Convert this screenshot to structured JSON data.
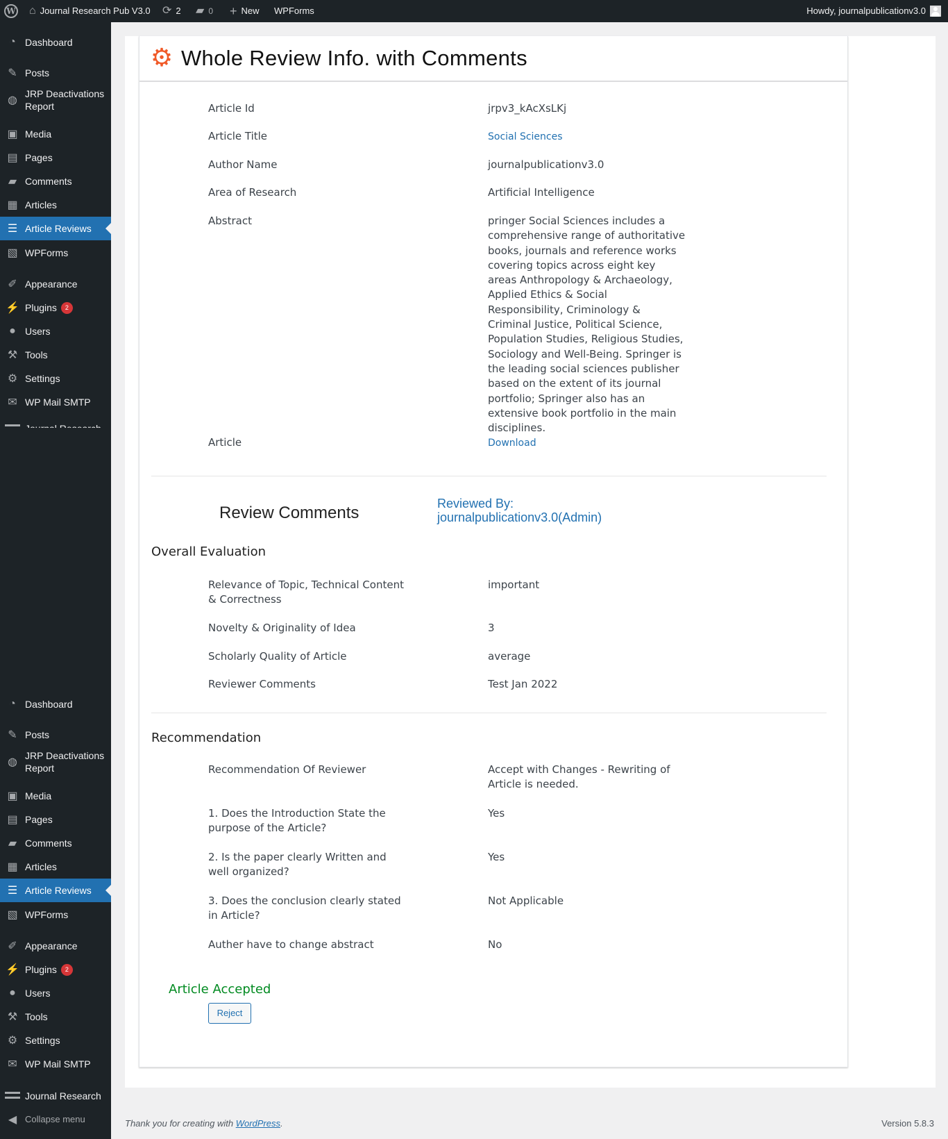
{
  "adminbar": {
    "site_title": "Journal Research Pub V3.0",
    "updates_count": "2",
    "comments_count": "0",
    "new_label": "New",
    "wpforms_label": "WPForms",
    "howdy": "Howdy, journalpublicationv3.0"
  },
  "sidebar": {
    "items": [
      {
        "label": "Dashboard",
        "icon": "dashboard-icon"
      },
      {
        "label": "Posts",
        "icon": "pin-icon"
      },
      {
        "label": "JRP Deactivations Report",
        "icon": "globe-icon"
      },
      {
        "label": "Media",
        "icon": "media-icon"
      },
      {
        "label": "Pages",
        "icon": "pages-icon"
      },
      {
        "label": "Comments",
        "icon": "comment-icon"
      },
      {
        "label": "Articles",
        "icon": "document-icon"
      },
      {
        "label": "Article Reviews",
        "icon": "list-icon"
      },
      {
        "label": "WPForms",
        "icon": "form-icon"
      },
      {
        "label": "Appearance",
        "icon": "brush-icon"
      },
      {
        "label": "Plugins",
        "icon": "plugin-icon",
        "badge": "2"
      },
      {
        "label": "Users",
        "icon": "user-icon"
      },
      {
        "label": "Tools",
        "icon": "wrench-icon"
      },
      {
        "label": "Settings",
        "icon": "sliders-icon"
      },
      {
        "label": "WP Mail SMTP",
        "icon": "mail-icon"
      },
      {
        "label": "Journal Research",
        "icon": "journal-icon"
      }
    ],
    "collapse_label": "Collapse menu"
  },
  "page": {
    "title": "Whole Review Info. with Comments",
    "details": [
      {
        "label": "Article Id",
        "value": "jrpv3_kAcXsLKj"
      },
      {
        "label": "Article Title",
        "value": "Social Sciences"
      },
      {
        "label": "Author Name",
        "value": "journalpublicationv3.0"
      },
      {
        "label": "Area of Research",
        "value": "Artificial Intelligence"
      },
      {
        "label": "Abstract",
        "value": "pringer Social Sciences includes a comprehensive range of authoritative books, journals and reference works covering topics across eight key areas Anthropology & Archaeology, Applied Ethics & Social Responsibility, Criminology & Criminal Justice, Political Science, Population Studies, Religious Studies, Sociology and Well-Being. Springer is the leading social sciences publisher based on the extent of its journal portfolio; Springer also has an extensive book portfolio in the main disciplines."
      },
      {
        "label": "Article",
        "value": "Download"
      }
    ],
    "review_comments_title": "Review Comments",
    "reviewed_by": "Reviewed By: journalpublicationv3.0(Admin)",
    "overall_title": "Overall Evaluation",
    "overall": [
      {
        "label": "Relevance of Topic, Technical Content & Correctness",
        "value": "important"
      },
      {
        "label": "Novelty & Originality of Idea",
        "value": "3"
      },
      {
        "label": "Scholarly Quality of Article",
        "value": "average"
      },
      {
        "label": "Reviewer Comments",
        "value": "Test Jan 2022"
      }
    ],
    "recommendation_title": "Recommendation",
    "recommendation": [
      {
        "label": "Recommendation Of Reviewer",
        "value": "Accept with Changes - Rewriting of Article is needed."
      },
      {
        "label": "1. Does the Introduction State the purpose of the Article?",
        "value": "Yes"
      },
      {
        "label": "2. Is the paper clearly Written and well organized?",
        "value": "Yes"
      },
      {
        "label": "3. Does the conclusion clearly stated in Article?",
        "value": "Not Applicable"
      },
      {
        "label": "Auther have to change abstract",
        "value": "No"
      }
    ],
    "status": "Article Accepted",
    "reject_label": "Reject"
  },
  "footer": {
    "thanks_prefix": "Thank you for creating with",
    "wordpress_link": "WordPress",
    "thanks_suffix": ".",
    "version": "Version 5.8.3"
  },
  "colors": {
    "accent": "#2271b1",
    "sidebar_bg": "#1d2327",
    "accepted": "#008a20",
    "gear": "#f05a28"
  }
}
